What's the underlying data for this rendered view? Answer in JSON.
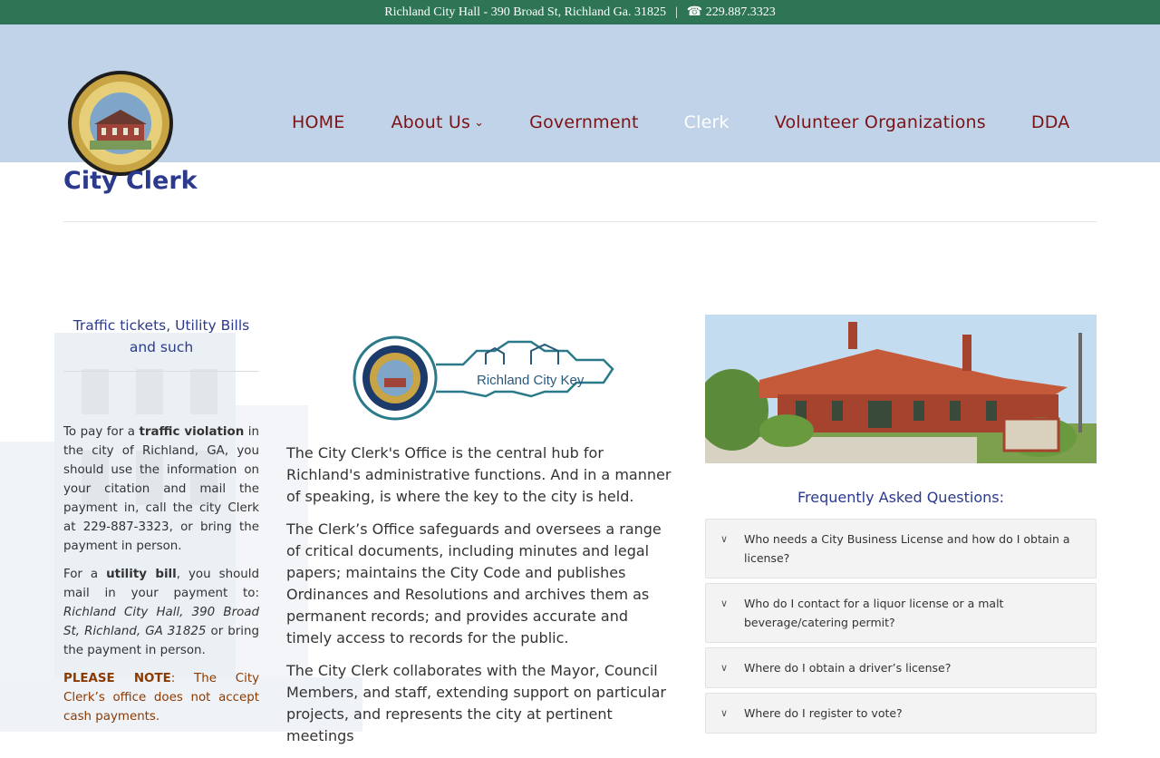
{
  "topbar": {
    "address": "Richland City Hall - 390 Broad St, Richland Ga. 31825",
    "separator": "|",
    "phone": "☎ 229.887.3323"
  },
  "nav": {
    "items": [
      {
        "label": "HOME",
        "active": false
      },
      {
        "label": "About Us",
        "active": false,
        "has_dropdown": true
      },
      {
        "label": "Government",
        "active": false
      },
      {
        "label": "Clerk",
        "active": true
      },
      {
        "label": "Volunteer Organizations",
        "active": false
      },
      {
        "label": "DDA",
        "active": false
      }
    ]
  },
  "page": {
    "title": "City Clerk"
  },
  "left": {
    "heading": "Traffic tickets, Utility Bills and such",
    "p1_pre": "To pay for a ",
    "p1_bold": "traffic violation",
    "p1_post": " in the city of Richland, GA, you should use the information on your citation and mail the payment in, call the city Clerk at 229-887-3323, or bring the payment in person.",
    "p2_pre": "For a ",
    "p2_bold": "utility bill",
    "p2_mid": ", you should mail in your payment to: ",
    "p2_ital": "Richland City Hall, 390 Broad St, Richland, GA 31825",
    "p2_post": " or bring the payment in person.",
    "note_bold": "PLEASE NOTE",
    "note_text": ": The City Clerk’s office does not accept cash payments."
  },
  "middle": {
    "key_logo_text": "Richland City Key",
    "paragraphs": [
      "The City Clerk's Office is the central hub for Richland's administrative functions.  And in a manner of speaking, is where the key to the city is held.",
      "The Clerk’s Office safeguards and oversees a range of critical documents, including minutes and legal papers; maintains the City Code and publishes Ordinances and Resolutions and archives them as permanent records; and provides accurate and timely access to records for the public.",
      "The City Clerk collaborates with the Mayor, Council Members, and staff, extending support on particular projects, and represents the city at pertinent meetings"
    ]
  },
  "right": {
    "faq_title": "Frequently Asked Questions:",
    "faqs": [
      "Who needs a City Business License and how do I obtain a license?",
      "Who do I contact for a liquor license or a malt beverage/catering permit?",
      "Where do I obtain a driver’s license?",
      "Where do I register to vote?"
    ]
  },
  "colors": {
    "topbar": "#2d7555",
    "header": "#c0d3e8",
    "nav_text": "#7b1416",
    "title": "#2b3a8c",
    "note": "#8b3a00"
  }
}
